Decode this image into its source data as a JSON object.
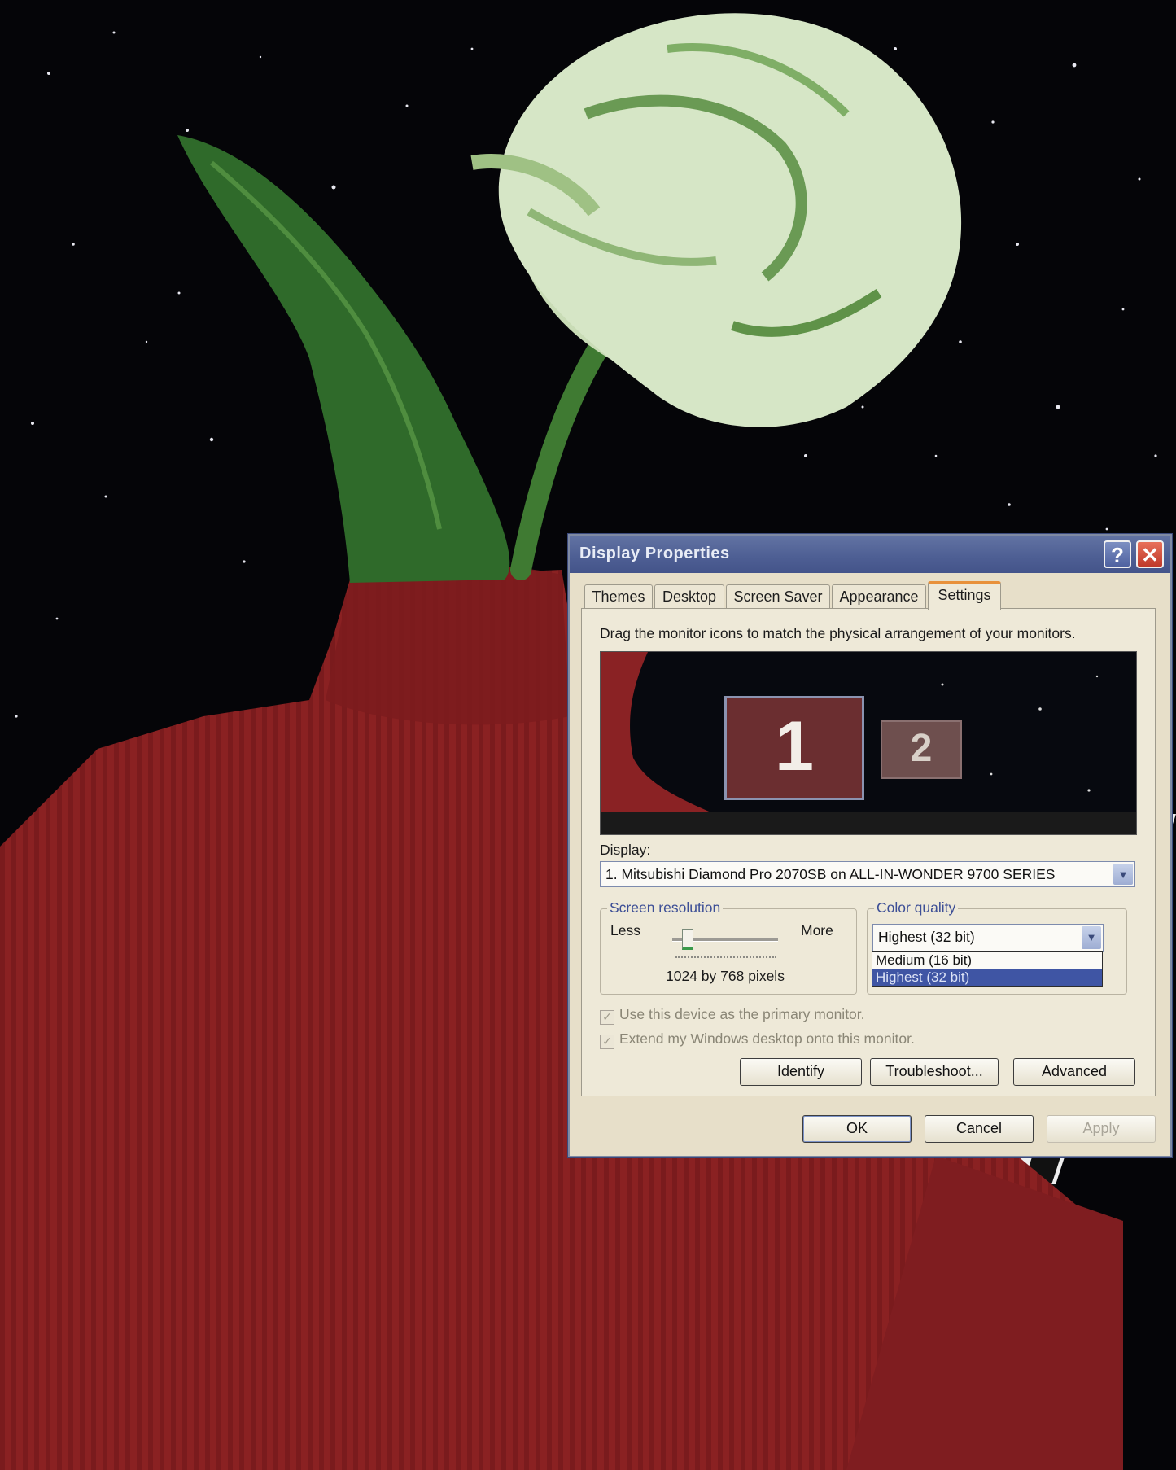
{
  "dialog": {
    "title": "Display Properties",
    "help_glyph": "?",
    "close_glyph": "✕",
    "tabs": [
      {
        "label": "Themes"
      },
      {
        "label": "Desktop"
      },
      {
        "label": "Screen Saver"
      },
      {
        "label": "Appearance"
      },
      {
        "label": "Settings",
        "active": true
      }
    ],
    "instruction": "Drag the monitor icons to match the physical arrangement of your monitors.",
    "monitors": [
      {
        "label": "1"
      },
      {
        "label": "2"
      }
    ],
    "display_label": "Display:",
    "display_value": "1. Mitsubishi Diamond Pro 2070SB on ALL-IN-WONDER 9700 SERIES",
    "resolution": {
      "legend": "Screen resolution",
      "less": "Less",
      "more": "More",
      "value": "1024 by 768 pixels"
    },
    "color_quality": {
      "legend": "Color quality",
      "selected": "Highest (32 bit)",
      "options": [
        "Medium (16 bit)",
        "Highest (32 bit)"
      ]
    },
    "checkboxes": [
      {
        "label": "Use this device as the primary monitor.",
        "checked": true,
        "enabled": false
      },
      {
        "label": "Extend my Windows desktop onto this monitor.",
        "checked": true,
        "enabled": false
      }
    ],
    "buttons": {
      "identify": "Identify",
      "troubleshoot": "Troubleshoot...",
      "advanced": "Advanced",
      "ok": "OK",
      "cancel": "Cancel",
      "apply": "Apply"
    },
    "colors": {
      "titlebar": "#4d5e93",
      "dialog_bg": "#e7dfc9",
      "selected_item": "#3f55a4",
      "active_tab_accent": "#e8913b"
    }
  }
}
